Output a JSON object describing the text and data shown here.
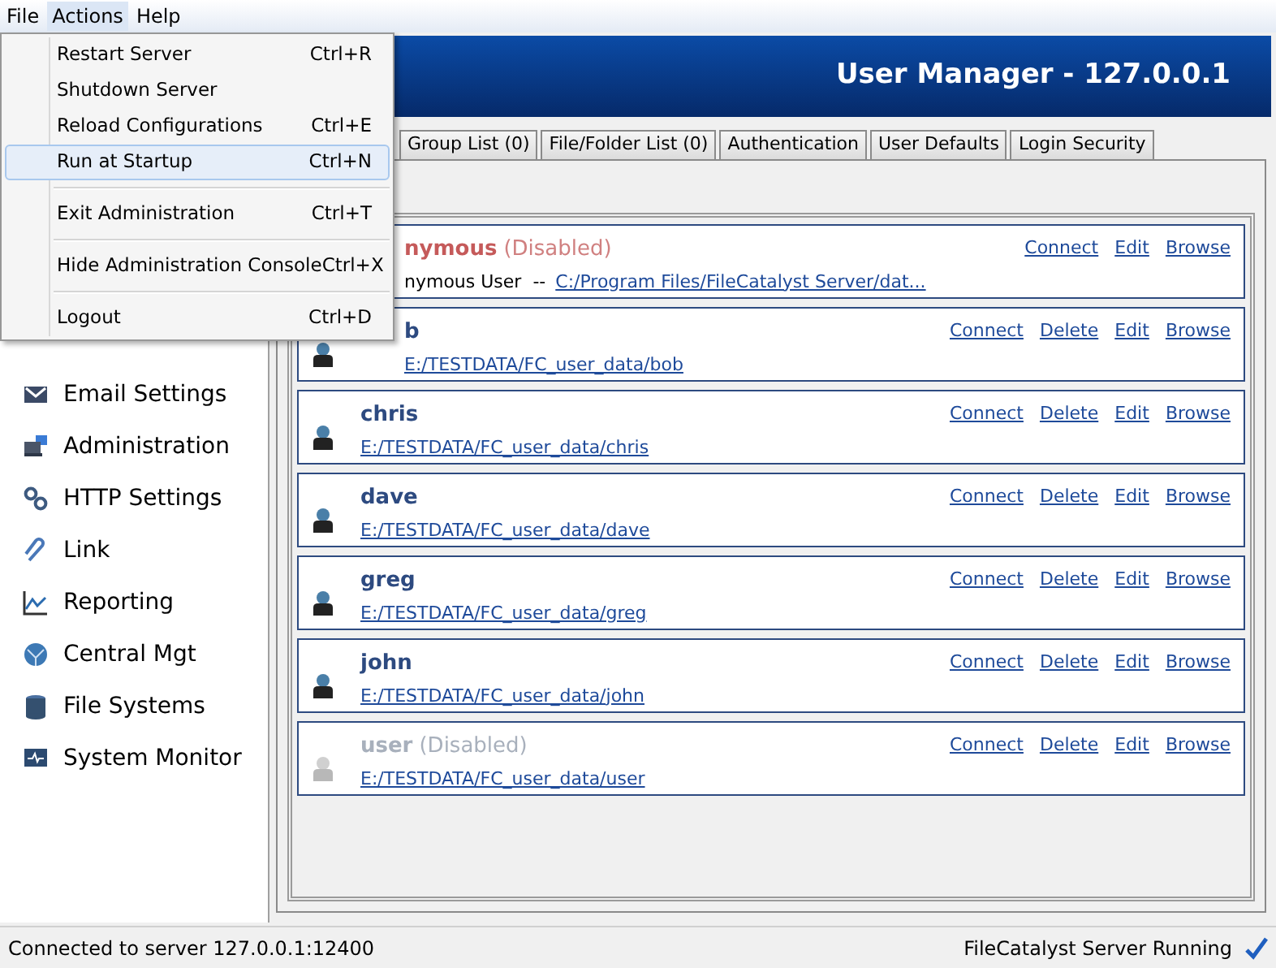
{
  "menubar": [
    {
      "label": "File",
      "selected": false
    },
    {
      "label": "Actions",
      "selected": true
    },
    {
      "label": "Help",
      "selected": false
    }
  ],
  "menu": [
    {
      "kind": "item",
      "label": "Restart Server",
      "shortcut": "Ctrl+R",
      "selected": false
    },
    {
      "kind": "item",
      "label": "Shutdown Server",
      "selected": false
    },
    {
      "kind": "item",
      "label": "Reload Configurations",
      "shortcut": "Ctrl+E",
      "selected": false
    },
    {
      "kind": "item",
      "label": "Run at Startup",
      "shortcut": "Ctrl+N",
      "selected": true
    },
    {
      "kind": "separator"
    },
    {
      "kind": "item",
      "label": "Exit Administration",
      "shortcut": "Ctrl+T",
      "selected": false
    },
    {
      "kind": "separator"
    },
    {
      "kind": "item",
      "label": "Hide Administration Console",
      "shortcut": "Ctrl+X",
      "selected": false
    },
    {
      "kind": "separator"
    },
    {
      "kind": "item",
      "label": "Logout",
      "shortcut": "Ctrl+D",
      "selected": false
    }
  ],
  "header": {
    "title": "User Manager - 127.0.0.1"
  },
  "sidebar": {
    "items": [
      {
        "label": "Email Settings"
      },
      {
        "label": "Administration"
      },
      {
        "label": "HTTP Settings"
      },
      {
        "label": "Link"
      },
      {
        "label": "Reporting"
      },
      {
        "label": "Central Mgt"
      },
      {
        "label": "File Systems"
      },
      {
        "label": "System Monitor"
      }
    ]
  },
  "tabs": [
    {
      "label": "Group List (0)",
      "selected": false
    },
    {
      "label": "File/Folder List (0)",
      "selected": false
    },
    {
      "label": "Authentication",
      "selected": false
    },
    {
      "label": "User Defaults",
      "selected": false
    },
    {
      "label": "Login Security",
      "selected": false
    }
  ],
  "users": [
    {
      "kind": "anonymous",
      "under_menu": true,
      "name": "nymous",
      "disabled": true,
      "disabled_label": "(Disabled)",
      "detail": "nymous User  --",
      "path": "C:/Program Files/FileCatalyst Server/dat...",
      "actions": [
        "Connect",
        "Edit",
        "Browse"
      ]
    },
    {
      "kind": "user",
      "under_menu": true,
      "name": "b",
      "disabled": false,
      "path": "E:/TESTDATA/FC_user_data/bob",
      "actions": [
        "Connect",
        "Delete",
        "Edit",
        "Browse"
      ]
    },
    {
      "kind": "user",
      "under_menu": false,
      "name": "chris",
      "disabled": false,
      "path": "E:/TESTDATA/FC_user_data/chris",
      "actions": [
        "Connect",
        "Delete",
        "Edit",
        "Browse"
      ]
    },
    {
      "kind": "user",
      "under_menu": false,
      "name": "dave",
      "disabled": false,
      "path": "E:/TESTDATA/FC_user_data/dave",
      "actions": [
        "Connect",
        "Delete",
        "Edit",
        "Browse"
      ]
    },
    {
      "kind": "user",
      "under_menu": false,
      "name": "greg",
      "disabled": false,
      "path": "E:/TESTDATA/FC_user_data/greg",
      "actions": [
        "Connect",
        "Delete",
        "Edit",
        "Browse"
      ]
    },
    {
      "kind": "user",
      "under_menu": false,
      "name": "john",
      "disabled": false,
      "path": "E:/TESTDATA/FC_user_data/john",
      "actions": [
        "Connect",
        "Delete",
        "Edit",
        "Browse"
      ]
    },
    {
      "kind": "user",
      "under_menu": false,
      "name": "user",
      "disabled": true,
      "disabled_label": "(Disabled)",
      "path": "E:/TESTDATA/FC_user_data/user",
      "actions": [
        "Connect",
        "Delete",
        "Edit",
        "Browse"
      ]
    }
  ],
  "status_bar": {
    "left": "Connected to server 127.0.0.1:12400",
    "right": "FileCatalyst Server Running"
  }
}
